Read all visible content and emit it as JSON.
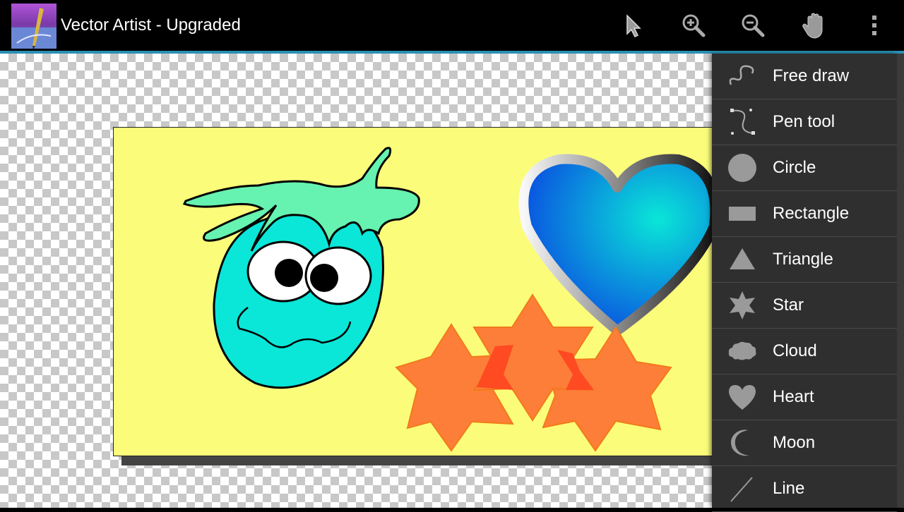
{
  "app": {
    "title": "Vector Artist - Upgraded"
  },
  "toolbar": {
    "actions": [
      {
        "name": "select",
        "icon": "arrow-pointer-icon"
      },
      {
        "name": "zoom-in",
        "icon": "zoom-in-icon"
      },
      {
        "name": "zoom-out",
        "icon": "zoom-out-icon"
      },
      {
        "name": "pan",
        "icon": "hand-icon"
      },
      {
        "name": "overflow",
        "icon": "more-vert-icon"
      }
    ]
  },
  "menu": {
    "items": [
      {
        "label": "Free draw",
        "icon": "free-draw-icon"
      },
      {
        "label": "Pen tool",
        "icon": "pen-tool-icon"
      },
      {
        "label": "Circle",
        "icon": "circle-icon"
      },
      {
        "label": "Rectangle",
        "icon": "rectangle-icon"
      },
      {
        "label": "Triangle",
        "icon": "triangle-icon"
      },
      {
        "label": "Star",
        "icon": "star-icon"
      },
      {
        "label": "Cloud",
        "icon": "cloud-icon"
      },
      {
        "label": "Heart",
        "icon": "heart-icon"
      },
      {
        "label": "Moon",
        "icon": "moon-icon"
      },
      {
        "label": "Line",
        "icon": "line-icon"
      }
    ]
  },
  "colors": {
    "accent": "#2c8fb4",
    "canvas_bg": "#fbfd7a",
    "menu_bg": "#2f2f2f",
    "blob_fill": "#0ae6d8",
    "hair_fill": "#66f2b0",
    "star_fill": "#fd7e38",
    "heart_fill": "#0a7be0"
  }
}
